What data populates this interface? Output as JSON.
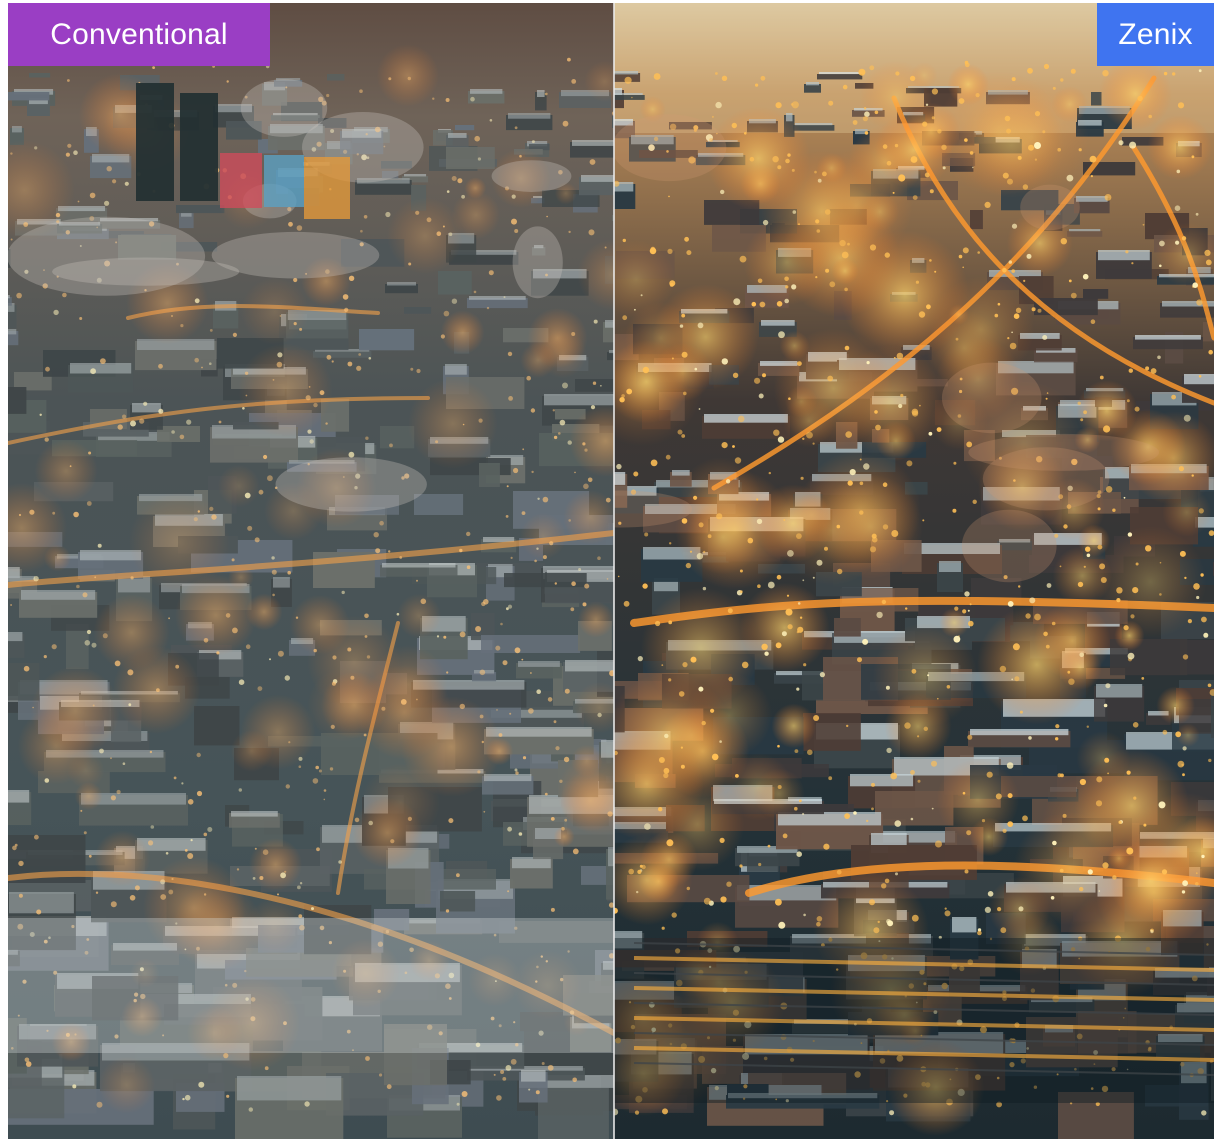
{
  "comparison": {
    "left_label": "Conventional",
    "right_label": "Zenix",
    "left_color": "#9a3ec4",
    "right_color": "#3f74f0",
    "left_style": "muted aerial winter city at dusk",
    "right_style": "enhanced aerial winter city at dusk with warm glowing lights"
  }
}
